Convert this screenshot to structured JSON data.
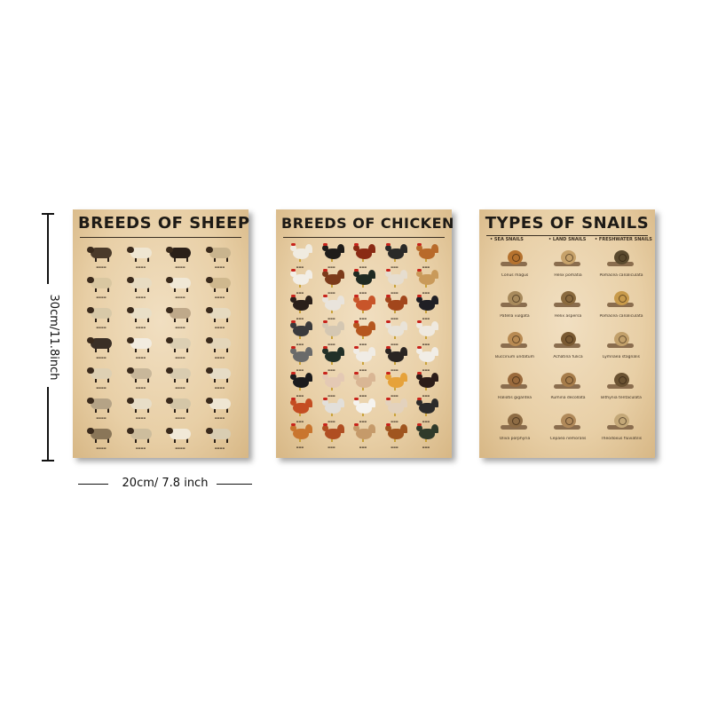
{
  "dimensions": {
    "height_label": "30cm/11.8inch",
    "width_label": "20cm/ 7.8 inch"
  },
  "posters": {
    "sheep": {
      "title": "BREEDS OF SHEEP",
      "colors": [
        "#4a3a2a",
        "#efe6d2",
        "#2a1f18",
        "#c9b48e",
        "#d9c7a1",
        "#e8dcc2",
        "#f0e8d6",
        "#cfb88e",
        "#d8c9a8",
        "#e9dfc7",
        "#bfa98a",
        "#e6dac0",
        "#3a2f26",
        "#f2ece0",
        "#dccfb3",
        "#e4d6ba",
        "#ded0b3",
        "#c8b79a",
        "#d9ccb0",
        "#e6dcc6",
        "#b5a386",
        "#e8dec8",
        "#d4c6a7",
        "#efe6d3",
        "#8a7658",
        "#cdbd9d",
        "#f1e9d8",
        "#d9cdb2"
      ]
    },
    "chicken": {
      "title": "BREEDS OF CHICKEN",
      "colors": [
        "#f0ebe0",
        "#1e1c1a",
        "#8a2a14",
        "#2a2a28",
        "#b86a2a",
        "#f2eee6",
        "#7c3a1a",
        "#1f2a22",
        "#e6ddcf",
        "#c99a5a",
        "#2a1f1a",
        "#e9e4dc",
        "#c8552a",
        "#a2461c",
        "#1f1f24",
        "#3a3a3c",
        "#d4c7b2",
        "#b5561f",
        "#e9e3d8",
        "#efe9df",
        "#6a6a6a",
        "#223028",
        "#f0ece5",
        "#2a2523",
        "#f1ede6",
        "#1b1b1d",
        "#e4c9b4",
        "#d9b694",
        "#e6a23a",
        "#2c1d18",
        "#c44d22",
        "#e2dfda",
        "#f5f3ef",
        "#e3d2bd",
        "#2b2b2b",
        "#c9752e",
        "#b04e22",
        "#c59a6a",
        "#a0551f",
        "#2f3a2a"
      ]
    },
    "snails": {
      "title": "TYPES OF SNAILS",
      "categories": [
        "• SEA SNAILS",
        "• LAND SNAILS",
        "• FRESHWATER SNAILS"
      ],
      "items": [
        "Conus magus",
        "Helix pomatia",
        "Pomacea canaliculata",
        "Patella vulgata",
        "Helix aspersa",
        "Pomacea canaliculata",
        "Buccinum undatum",
        "Achatina fulica",
        "Lymnaea stagnalis",
        "Haliotis gigantea",
        "Rumina decollata",
        "Bithynia tentaculata",
        "Oliva porphyria",
        "Cepaea nemoralis",
        "Theodoxus fluviatilis"
      ],
      "colors": [
        "#b5722e",
        "#c7a26a",
        "#5a4a2e",
        "#a88a5c",
        "#8a6a3e",
        "#c89a4a",
        "#b88a52",
        "#7a5a32",
        "#c2a06a",
        "#9a6a3c",
        "#a67c4a",
        "#6a5232",
        "#8e6c44",
        "#b0895a",
        "#c4a878"
      ]
    }
  }
}
